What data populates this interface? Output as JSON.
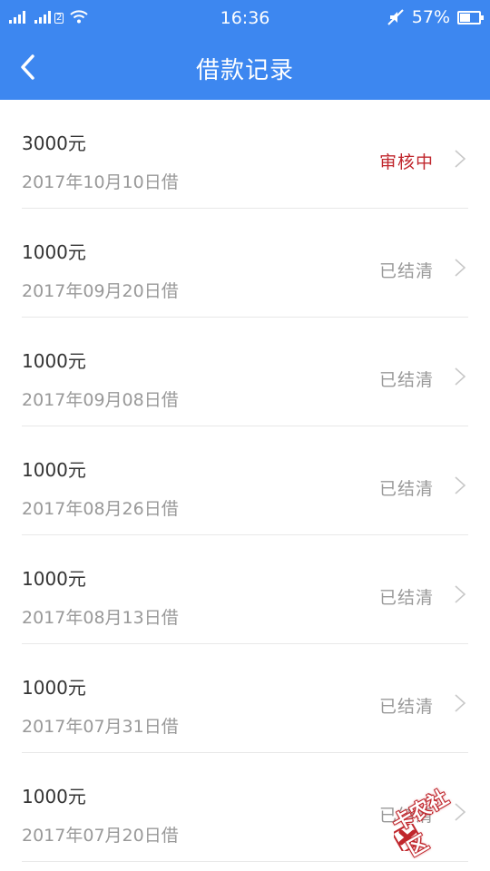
{
  "status_bar": {
    "sim2_label": "2",
    "time": "16:36",
    "battery_text": "57%",
    "battery_level": 0.57
  },
  "nav": {
    "title": "借款记录"
  },
  "records": [
    {
      "amount": "3000元",
      "date": "2017年10月10日借",
      "status": "审核中",
      "pending": true
    },
    {
      "amount": "1000元",
      "date": "2017年09月20日借",
      "status": "已结清",
      "pending": false
    },
    {
      "amount": "1000元",
      "date": "2017年09月08日借",
      "status": "已结清",
      "pending": false
    },
    {
      "amount": "1000元",
      "date": "2017年08月26日借",
      "status": "已结清",
      "pending": false
    },
    {
      "amount": "1000元",
      "date": "2017年08月13日借",
      "status": "已结清",
      "pending": false
    },
    {
      "amount": "1000元",
      "date": "2017年07月31日借",
      "status": "已结清",
      "pending": false
    },
    {
      "amount": "1000元",
      "date": "2017年07月20日借",
      "status": "已结清",
      "pending": false
    }
  ],
  "watermark": {
    "text": "卡农社区"
  },
  "colors": {
    "header_bg": "#3d87f0",
    "pending_status": "#c0272d",
    "settled_status": "#999999"
  },
  "icons": {
    "back": "chevron-left-icon",
    "row_arrow": "chevron-right-icon",
    "signal": "signal-icon",
    "wifi": "wifi-icon",
    "mute": "mute-icon",
    "battery": "battery-icon"
  }
}
